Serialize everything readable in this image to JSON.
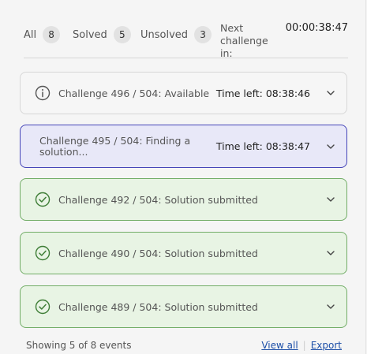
{
  "filters": {
    "all_label": "All",
    "all_count": "8",
    "solved_label": "Solved",
    "solved_count": "5",
    "unsolved_label": "Unsolved",
    "unsolved_count": "3"
  },
  "next_challenge": {
    "label": "Next challenge in:",
    "timer": "00:00:38:47"
  },
  "cards": [
    {
      "status": "available",
      "icon": "info-icon",
      "title": "Challenge 496 / 504: Available",
      "time_left": "Time left:  08:38:46"
    },
    {
      "status": "active",
      "title": "Challenge 495 / 504: Finding a solution...",
      "time_left": "Time left:  08:38:47"
    },
    {
      "status": "solved",
      "icon": "check-circle-icon",
      "title": "Challenge 492 / 504: Solution submitted"
    },
    {
      "status": "solved",
      "icon": "check-circle-icon",
      "title": "Challenge 490 / 504: Solution submitted"
    },
    {
      "status": "solved",
      "icon": "check-circle-icon",
      "title": "Challenge 489 / 504: Solution submitted"
    }
  ],
  "footer": {
    "summary": "Showing 5 of 8 events",
    "view_all": "View all",
    "export": "Export"
  },
  "colors": {
    "active_border": "#4444b8",
    "active_bg": "#e8e8f8",
    "solved_border": "#72ad67",
    "solved_bg": "#e8f4e4",
    "link": "#1d4fa8"
  }
}
